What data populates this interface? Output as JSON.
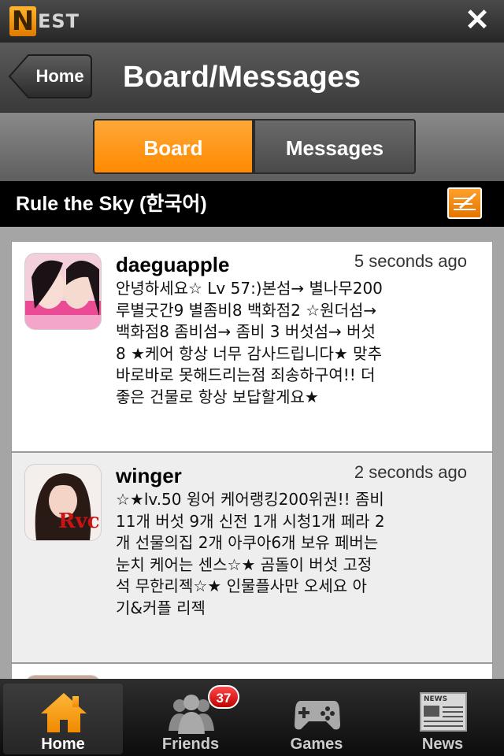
{
  "app": {
    "logo_letter": "N",
    "logo_text": "EST"
  },
  "nav": {
    "back_label": "Home",
    "title": "Board/Messages"
  },
  "segments": {
    "board": "Board",
    "messages": "Messages",
    "selected": "Board"
  },
  "game": {
    "title": "Rule the Sky (한국어)"
  },
  "posts": [
    {
      "user": "daeguapple",
      "time": "5 seconds ago",
      "lines": [
        "안녕하세요☆ Lv 57:)본섬→ 별나무200",
        "루별굿간9 별좀비8 백화점2 ☆원더섬→",
        "백화점8 좀비섬→ 좀비 3  버섯섬→ 버섯",
        "8 ★케어 항상 너무 감사드립니다★ 맞추",
        "바로바로 못해드리는점 죄송하구여!! 더",
        "좋은 건물로 항상 보답할게요★"
      ]
    },
    {
      "user": "winger",
      "time": "2 seconds ago",
      "lines": [
        "☆★lv.50 윙어 케어랭킹200위권!! 좀비",
        "11개 버섯 9개 신전 1개 시청1개 페라 2",
        "개 선물의집 2개 아쿠아6개 보유 페버는",
        "눈치 케어는 센스☆★ 곰돌이 버섯 고정",
        "석 무한리젝☆★ 인물플사만 오세요 아",
        "기&커플 리젝"
      ]
    }
  ],
  "tabs": {
    "home": "Home",
    "friends": "Friends",
    "friends_badge": "37",
    "games": "Games",
    "news": "News",
    "active": "Home"
  },
  "colors": {
    "accent": "#ff8a00",
    "badge": "#d40000"
  }
}
